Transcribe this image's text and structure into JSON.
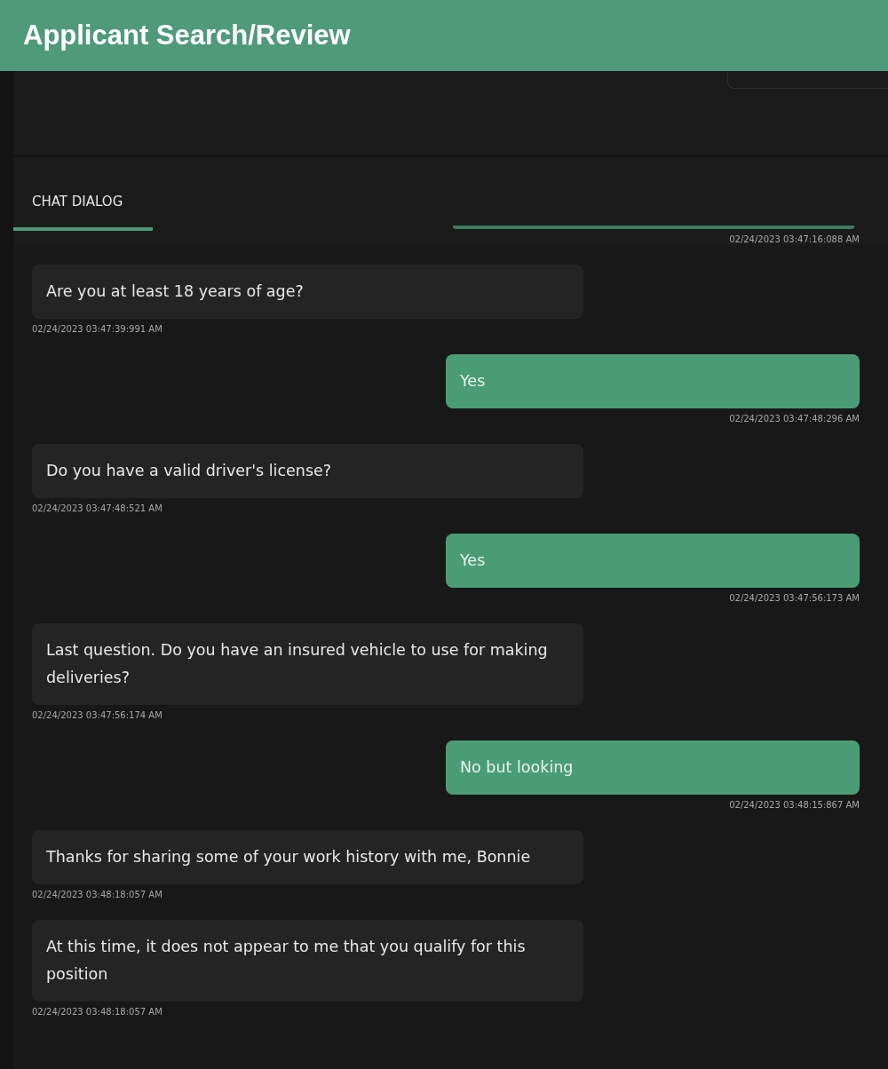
{
  "header": {
    "title": "Applicant Search/Review"
  },
  "tabs": [
    {
      "label": "CHAT DIALOG",
      "selected": true
    }
  ],
  "messages": [
    {
      "kind": "user",
      "clipped": true,
      "timestamp": "02/24/2023 03:47:16:088 AM"
    },
    {
      "kind": "bot",
      "text": "Are you at least 18 years of age?",
      "timestamp": "02/24/2023 03:47:39:991 AM"
    },
    {
      "kind": "user",
      "text": "Yes",
      "timestamp": "02/24/2023 03:47:48:296 AM"
    },
    {
      "kind": "bot",
      "text": "Do you have a valid driver's license?",
      "timestamp": "02/24/2023 03:47:48:521 AM"
    },
    {
      "kind": "user",
      "text": "Yes",
      "timestamp": "02/24/2023 03:47:56:173 AM"
    },
    {
      "kind": "bot",
      "text": "Last question. Do you have an insured vehicle to use for making deliveries?",
      "timestamp": "02/24/2023 03:47:56:174 AM"
    },
    {
      "kind": "user",
      "text": "No but looking",
      "timestamp": "02/24/2023 03:48:15:867 AM"
    },
    {
      "kind": "bot",
      "text": "Thanks for sharing some of your work history with me, Bonnie",
      "timestamp": "02/24/2023 03:48:18:057 AM"
    },
    {
      "kind": "bot",
      "text": "At this time, it does not appear to me that you qualify for this position",
      "timestamp": "02/24/2023 03:48:18:057 AM"
    }
  ]
}
